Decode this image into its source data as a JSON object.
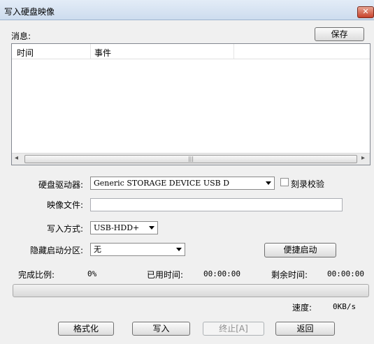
{
  "window": {
    "title": "写入硬盘映像",
    "close_glyph": "✕"
  },
  "messages": {
    "label": "消息:",
    "save_button": "保存",
    "columns": [
      "时间",
      "事件"
    ],
    "rows": [],
    "scroll_left_glyph": "◂",
    "scroll_right_glyph": "▸",
    "scroll_thumb_glyph": "|||"
  },
  "form": {
    "drive_label": "硬盘驱动器:",
    "drive_value": "Generic STORAGE DEVICE USB D",
    "verify_label": "刻录校验",
    "image_label": "映像文件:",
    "image_value": "",
    "write_mode_label": "写入方式:",
    "write_mode_value": "USB-HDD+",
    "hidden_partition_label": "隐藏启动分区:",
    "hidden_partition_value": "无",
    "quick_boot_button": "便捷启动"
  },
  "status": {
    "complete_label": "完成比例:",
    "complete_value": "0%",
    "complete_fraction": 0,
    "elapsed_label": "已用时间:",
    "elapsed_value": "00:00:00",
    "remaining_label": "剩余时间:",
    "remaining_value": "00:00:00",
    "speed_label": "速度:",
    "speed_value": "0KB/s"
  },
  "actions": {
    "format": "格式化",
    "write": "写入",
    "stop": "终止[A]",
    "back": "返回"
  }
}
